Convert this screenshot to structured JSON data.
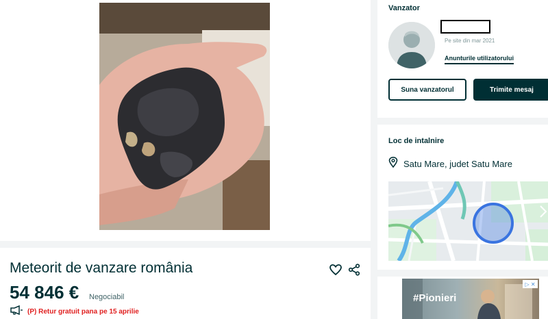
{
  "listing": {
    "title": "Meteorit de vanzare românia",
    "price": "54 846 €",
    "negotiable": "Negociabil",
    "promo": "(P) Retur gratuit pana pe 15 aprilie"
  },
  "seller": {
    "section_label": "Vanzator",
    "since": "Pe site din mar 2021",
    "user_ads_link": "Anunturile utilizatorului",
    "call_button": "Suna vanzatorul",
    "message_button": "Trimite mesaj"
  },
  "location": {
    "section_label": "Loc de intalnire",
    "address": "Satu Mare, judet Satu Mare"
  },
  "ad": {
    "hashtag": "#Pionieri",
    "badge": "▷ ✕"
  },
  "icons": {
    "heart": "heart-icon",
    "share": "share-icon",
    "megaphone": "megaphone-icon",
    "location_pin": "location-pin-icon"
  },
  "colors": {
    "primary": "#002f34",
    "accent_red": "#e02020",
    "map_highlight": "#3a74e0",
    "page_bg": "#f2f4f5"
  }
}
